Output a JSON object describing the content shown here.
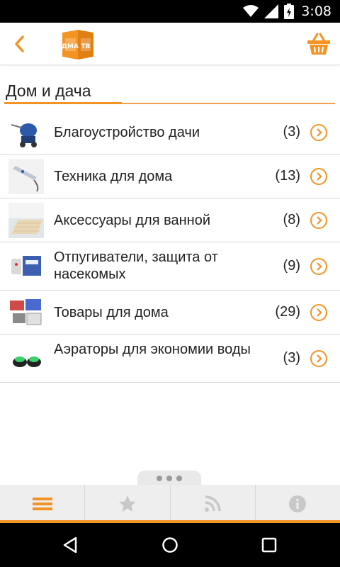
{
  "status_bar": {
    "time": "3:08"
  },
  "header": {
    "logo_text": "ДМА ТВ",
    "back_icon": "chevron-left-icon",
    "cart_icon": "basket-icon"
  },
  "section": {
    "title": "Дом и дача"
  },
  "categories": [
    {
      "label": "Благоустройство дачи",
      "count": "(3)",
      "icon": "sprayer-thumbnail"
    },
    {
      "label": "Техника для дома",
      "count": "(13)",
      "icon": "appliance-thumbnail"
    },
    {
      "label": "Аксессуары для ванной",
      "count": "(8)",
      "icon": "bath-mat-thumbnail"
    },
    {
      "label": "Отпугиватели, защита от насекомых",
      "count": "(9)",
      "icon": "repeller-thumbnail"
    },
    {
      "label": "Товары для дома",
      "count": "(29)",
      "icon": "home-goods-thumbnail"
    },
    {
      "label": "Аэраторы для экономии воды",
      "count": "(3)",
      "icon": "aerator-thumbnail"
    }
  ],
  "bottom_tabs": [
    {
      "icon": "menu-icon",
      "active": true
    },
    {
      "icon": "star-icon",
      "active": false
    },
    {
      "icon": "rss-icon",
      "active": false
    },
    {
      "icon": "info-icon",
      "active": false
    }
  ],
  "colors": {
    "accent": "#f39324",
    "tab_bg": "#eeeeee",
    "inactive_icon": "#c8c8c8"
  }
}
